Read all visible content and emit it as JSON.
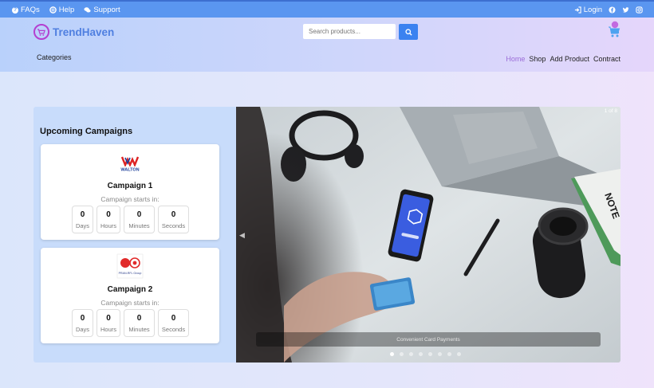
{
  "topbar": {
    "faqs": "FAQs",
    "help": "Help",
    "support": "Support",
    "login": "Login",
    "social_icons": [
      "facebook-icon",
      "twitter-icon",
      "instagram-icon"
    ]
  },
  "header": {
    "brand": "TrendHaven",
    "search_placeholder": "Search products...",
    "categories": "Categories",
    "nav": [
      "Home",
      "Shop",
      "Add Product",
      "Contract"
    ],
    "active_nav": "Home",
    "accent": "#3b82f0",
    "brand_color": "#4f7fe0"
  },
  "campaigns": {
    "heading": "Upcoming Campaigns",
    "items": [
      {
        "logo_text": "WALTON",
        "title": "Campaign 1",
        "starts": "Campaign starts in:",
        "days": "0",
        "hours": "0",
        "minutes": "0",
        "seconds": "0",
        "days_label": "Days",
        "hours_label": "Hours",
        "minutes_label": "Minutes",
        "seconds_label": "Seconds"
      },
      {
        "logo_text": "PRAN-RFL Group",
        "title": "Campaign 2",
        "starts": "Campaign starts in:",
        "days": "0",
        "hours": "0",
        "minutes": "0",
        "seconds": "0",
        "days_label": "Days",
        "hours_label": "Hours",
        "minutes_label": "Minutes",
        "seconds_label": "Seconds"
      }
    ]
  },
  "slider": {
    "counter": "1 of 8",
    "caption": "Convenient Card Payments",
    "phone_text": "BLOCKCHAIN",
    "notebook_text": "NOTE",
    "slide_count": 8,
    "active_slide": 1
  }
}
